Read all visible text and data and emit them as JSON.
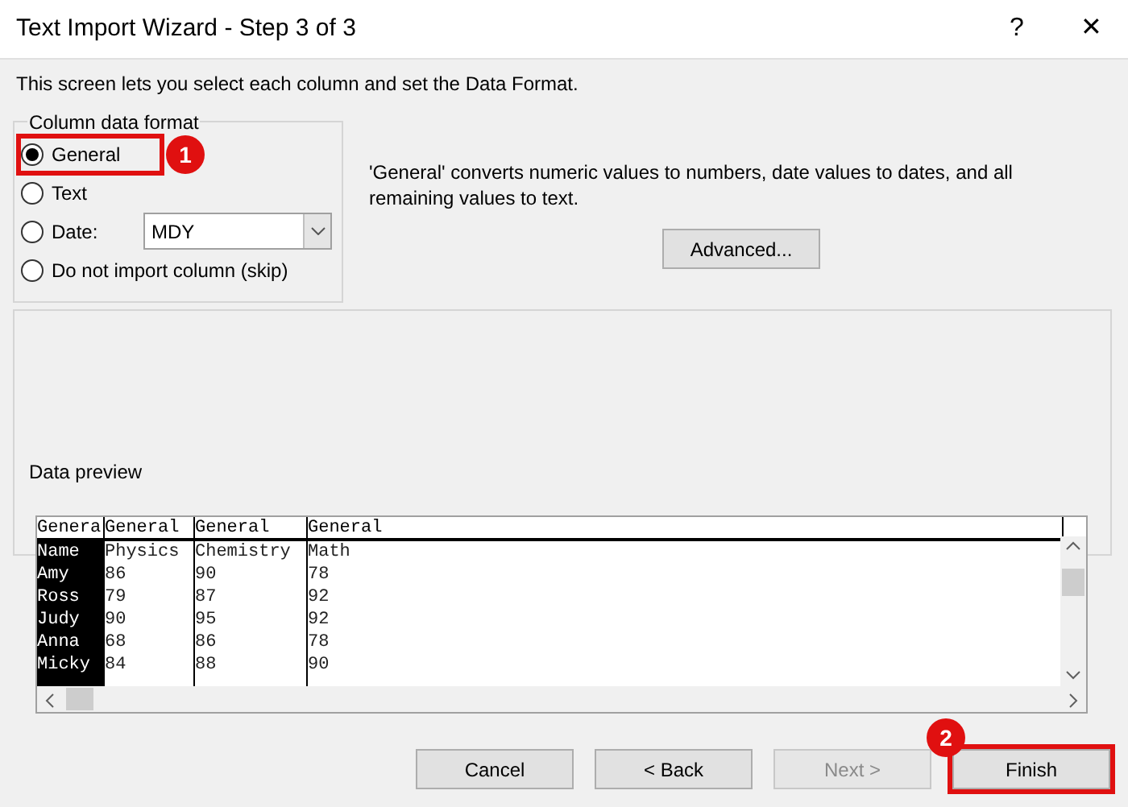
{
  "window": {
    "title": "Text Import Wizard - Step 3 of 3",
    "help": "?",
    "close": "✕"
  },
  "description": "This screen lets you select each column and set the Data Format.",
  "column_format": {
    "legend": "Column data format",
    "options": [
      {
        "label": "General",
        "selected": true,
        "kind": "plain"
      },
      {
        "label": "Text",
        "selected": false,
        "kind": "plain"
      },
      {
        "label": "Date:",
        "selected": false,
        "kind": "date"
      },
      {
        "label": "Do not import column (skip)",
        "selected": false,
        "kind": "plain"
      }
    ],
    "date_value": "MDY"
  },
  "info_text": "'General' converts numeric values to numbers, date values to dates, and all remaining values to text.",
  "advanced_button": "Advanced...",
  "preview": {
    "legend": "Data preview",
    "columns": [
      {
        "header": "Genera",
        "selected": true
      },
      {
        "header": "General",
        "selected": false
      },
      {
        "header": "General",
        "selected": false
      },
      {
        "header": "General",
        "selected": false
      }
    ],
    "rows": [
      [
        "Name",
        "Physics",
        "Chemistry",
        "Math"
      ],
      [
        "Amy",
        "86",
        "90",
        "78"
      ],
      [
        "Ross",
        "79",
        "87",
        "92"
      ],
      [
        "Judy",
        "90",
        "95",
        "92"
      ],
      [
        "Anna",
        "68",
        "86",
        "78"
      ],
      [
        "Micky",
        "84",
        "88",
        "90"
      ]
    ]
  },
  "buttons": [
    {
      "label": "Cancel",
      "disabled": false,
      "highlighted": false
    },
    {
      "label": "< Back",
      "disabled": false,
      "highlighted": false
    },
    {
      "label": "Next >",
      "disabled": true,
      "highlighted": false
    },
    {
      "label": "Finish",
      "disabled": false,
      "highlighted": true
    }
  ],
  "callouts": [
    "1",
    "2"
  ]
}
